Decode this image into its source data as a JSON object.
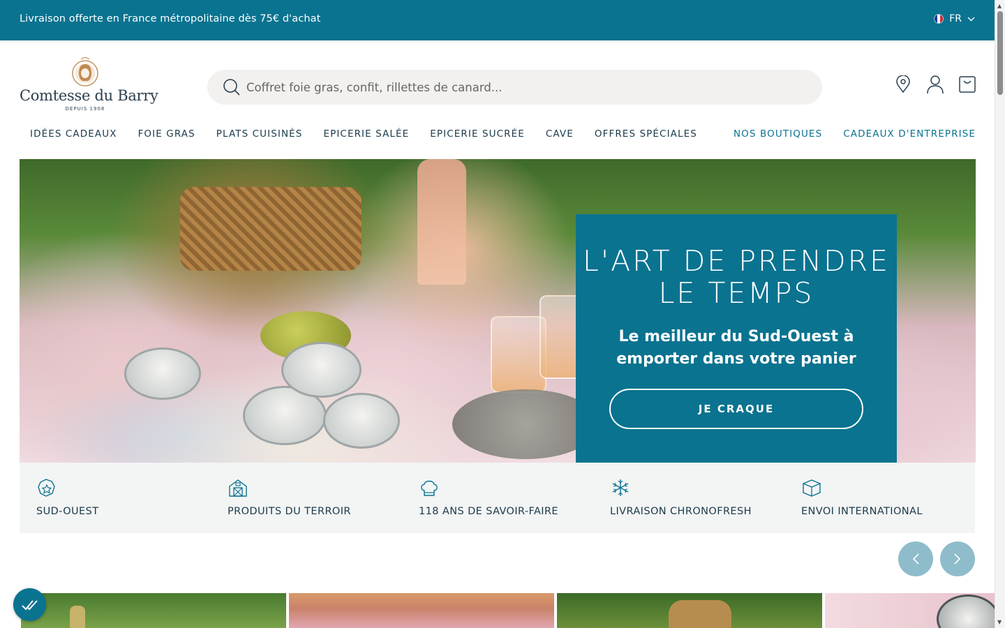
{
  "promo": {
    "text": "Livraison offerte en France métropolitaine dès 75€ d'achat"
  },
  "lang": {
    "code": "FR"
  },
  "logo": {
    "name": "Comtesse du Barry",
    "since": "DEPUIS 1908"
  },
  "search": {
    "placeholder": "Coffret foie gras, confit, rillettes de canard..."
  },
  "header_icons": [
    "location-icon",
    "account-icon",
    "cart-icon"
  ],
  "nav": {
    "left": [
      "IDÉES CADEAUX",
      "FOIE GRAS",
      "PLATS CUISINÉS",
      "EPICERIE SALÉE",
      "EPICERIE SUCRÉE",
      "CAVE",
      "OFFRES SPÉCIALES"
    ],
    "right": [
      "NOS BOUTIQUES",
      "CADEAUX D'ENTREPRISE"
    ]
  },
  "hero": {
    "title": "L'ART DE PRENDRE LE TEMPS",
    "subtitle": "Le meilleur du Sud-Ouest à emporter dans votre panier",
    "cta": "JE CRAQUE"
  },
  "features": [
    {
      "icon": "region-map-icon",
      "label": "SUD-OUEST"
    },
    {
      "icon": "barn-icon",
      "label": "PRODUITS DU TERROIR"
    },
    {
      "icon": "chef-hat-icon",
      "label": "118 ANS DE SAVOIR-FAIRE"
    },
    {
      "icon": "snowflake-icon",
      "label": "LIVRAISON CHRONOFRESH"
    },
    {
      "icon": "package-icon",
      "label": "ENVOI INTERNATIONAL"
    }
  ],
  "colors": {
    "brand": "#0a7390",
    "nav_text": "#1b3a4b",
    "feature_bg": "#f3f4f4",
    "carousel_btn": "#8fbccb"
  }
}
